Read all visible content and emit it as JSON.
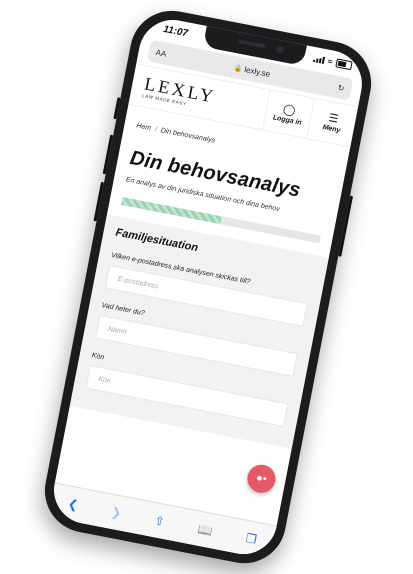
{
  "status_bar": {
    "time": "11:07"
  },
  "browser": {
    "text_size": "AA",
    "url": "lexly.se",
    "reload_icon": "reload-icon"
  },
  "header": {
    "logo": "LEXLY",
    "tagline": "LAW MADE EASY",
    "login_label": "Logga in",
    "menu_label": "Meny"
  },
  "breadcrumb": {
    "home": "Hem",
    "separator": "/",
    "current": "Din behovsanalys"
  },
  "page": {
    "title": "Din behovsanalys",
    "subtitle": "En analys av din juridiska situation och dina behov",
    "progress_fraction": 0.5
  },
  "section": {
    "title": "Familjesituation",
    "fields": [
      {
        "question": "Vilken e-postadress ska analysen skickas till?",
        "placeholder": "E-postadress"
      },
      {
        "question": "Vad heter du?",
        "placeholder": "Namn"
      },
      {
        "question": "Kön",
        "placeholder": "Kön"
      }
    ]
  },
  "colors": {
    "accent": "#e35a66",
    "progress": "#9ad2b1",
    "safari_blue": "#2f6de1"
  },
  "toolbar": {
    "icons": [
      "back-icon",
      "forward-icon",
      "share-icon",
      "bookmarks-icon",
      "tabs-icon"
    ]
  }
}
